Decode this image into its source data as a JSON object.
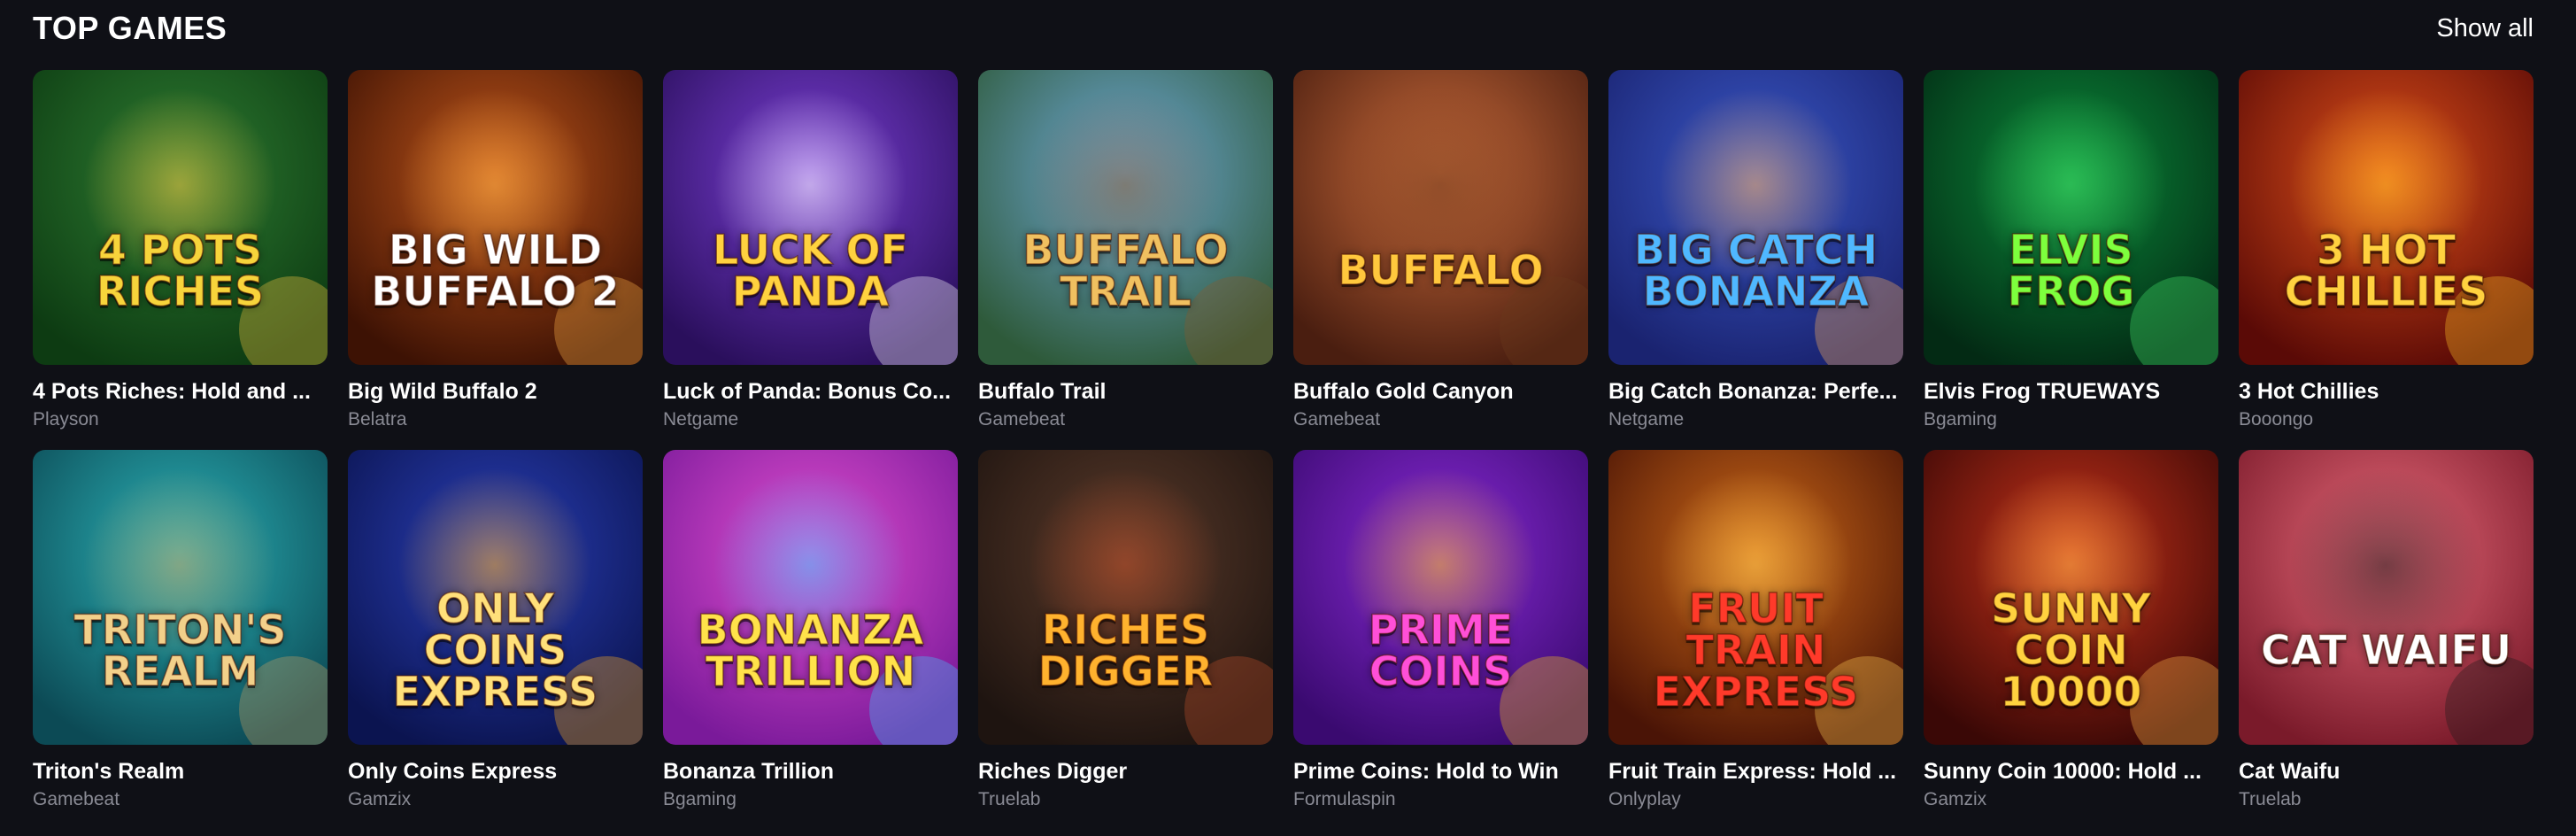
{
  "section": {
    "title": "TOP GAMES",
    "show_all": "Show all"
  },
  "games": [
    {
      "name": "4 Pots Riches: Hold and ...",
      "provider": "Playson",
      "logo": "4 POTS RICHES",
      "bg1": "#2e7d32",
      "bg2": "#0d3b12",
      "accent": "#f5c542",
      "logo_color": "#f7d43b"
    },
    {
      "name": "Big Wild Buffalo 2",
      "provider": "Belatra",
      "logo": "BIG WILD BUFFALO 2",
      "bg1": "#c0551a",
      "bg2": "#3d1204",
      "accent": "#ffb347",
      "logo_color": "#ffffff"
    },
    {
      "name": "Luck of Panda: Bonus Co...",
      "provider": "Netgame",
      "logo": "LUCK OF PANDA",
      "bg1": "#7b3fd6",
      "bg2": "#2a0f5c",
      "accent": "#ffffff",
      "logo_color": "#ffd23f"
    },
    {
      "name": "Buffalo Trail",
      "provider": "Gamebeat",
      "logo": "BUFFALO TRAIL",
      "bg1": "#6fa8d6",
      "bg2": "#2e5a3a",
      "accent": "#8a5a2b",
      "logo_color": "#f0c060"
    },
    {
      "name": "Buffalo Gold Canyon",
      "provider": "Gamebeat",
      "logo": "BUFFALO",
      "bg1": "#c96a3a",
      "bg2": "#4a1e10",
      "accent": "#6b3a1e",
      "logo_color": "#ffc83d"
    },
    {
      "name": "Big Catch Bonanza: Perfe...",
      "provider": "Netgame",
      "logo": "BIG CATCH BONANZA",
      "bg1": "#3a58c8",
      "bg2": "#1a2370",
      "accent": "#ffb15c",
      "logo_color": "#4fb8ff"
    },
    {
      "name": "Elvis Frog TRUEWAYS",
      "provider": "Bgaming",
      "logo": "ELVIS FROG",
      "bg1": "#0a8a3a",
      "bg2": "#032a14",
      "accent": "#46e66b",
      "logo_color": "#7dff3d"
    },
    {
      "name": "3 Hot Chillies",
      "provider": "Booongo",
      "logo": "3 HOT CHILLIES",
      "bg1": "#e0501a",
      "bg2": "#5a0a06",
      "accent": "#ffc226",
      "logo_color": "#ffd23f"
    },
    {
      "name": "Triton's Realm",
      "provider": "Gamebeat",
      "logo": "TRITON'S REALM",
      "bg1": "#2bb3b8",
      "bg2": "#0c4a55",
      "accent": "#c8a060",
      "logo_color": "#f2d08a"
    },
    {
      "name": "Only Coins Express",
      "provider": "Gamzix",
      "logo": "ONLY COINS EXPRESS",
      "bg1": "#2a3fb8",
      "bg2": "#0b1450",
      "accent": "#ffb020",
      "logo_color": "#ffe07a"
    },
    {
      "name": "Bonanza Trillion",
      "provider": "Bgaming",
      "logo": "BONANZA TRILLION",
      "bg1": "#e24fd0",
      "bg2": "#7a1a9a",
      "accent": "#3fc6ff",
      "logo_color": "#ffe24a"
    },
    {
      "name": "Riches Digger",
      "provider": "Truelab",
      "logo": "RICHES DIGGER",
      "bg1": "#5a3a2a",
      "bg2": "#1e1410",
      "accent": "#c0502a",
      "logo_color": "#ffb22e"
    },
    {
      "name": "Prime Coins: Hold to Win",
      "provider": "Formulaspin",
      "logo": "PRIME COINS",
      "bg1": "#8a2ad6",
      "bg2": "#3a0a70",
      "accent": "#f5c11a",
      "logo_color": "#ff4fd8"
    },
    {
      "name": "Fruit Train Express: Hold ...",
      "provider": "Onlyplay",
      "logo": "FRUIT TRAIN EXPRESS",
      "bg1": "#d06a18",
      "bg2": "#4a1406",
      "accent": "#ffcb52",
      "logo_color": "#ff3a2a"
    },
    {
      "name": "Sunny Coin 10000: Hold ...",
      "provider": "Gamzix",
      "logo": "SUNNY COIN 10000",
      "bg1": "#c8321a",
      "bg2": "#3a0806",
      "accent": "#ffb84a",
      "logo_color": "#ffd23f"
    },
    {
      "name": "Cat Waifu",
      "provider": "Truelab",
      "logo": "CAT WAIFU",
      "bg1": "#e86a7a",
      "bg2": "#7a1a2a",
      "accent": "#1a1a1a",
      "logo_color": "#ffffff"
    }
  ]
}
